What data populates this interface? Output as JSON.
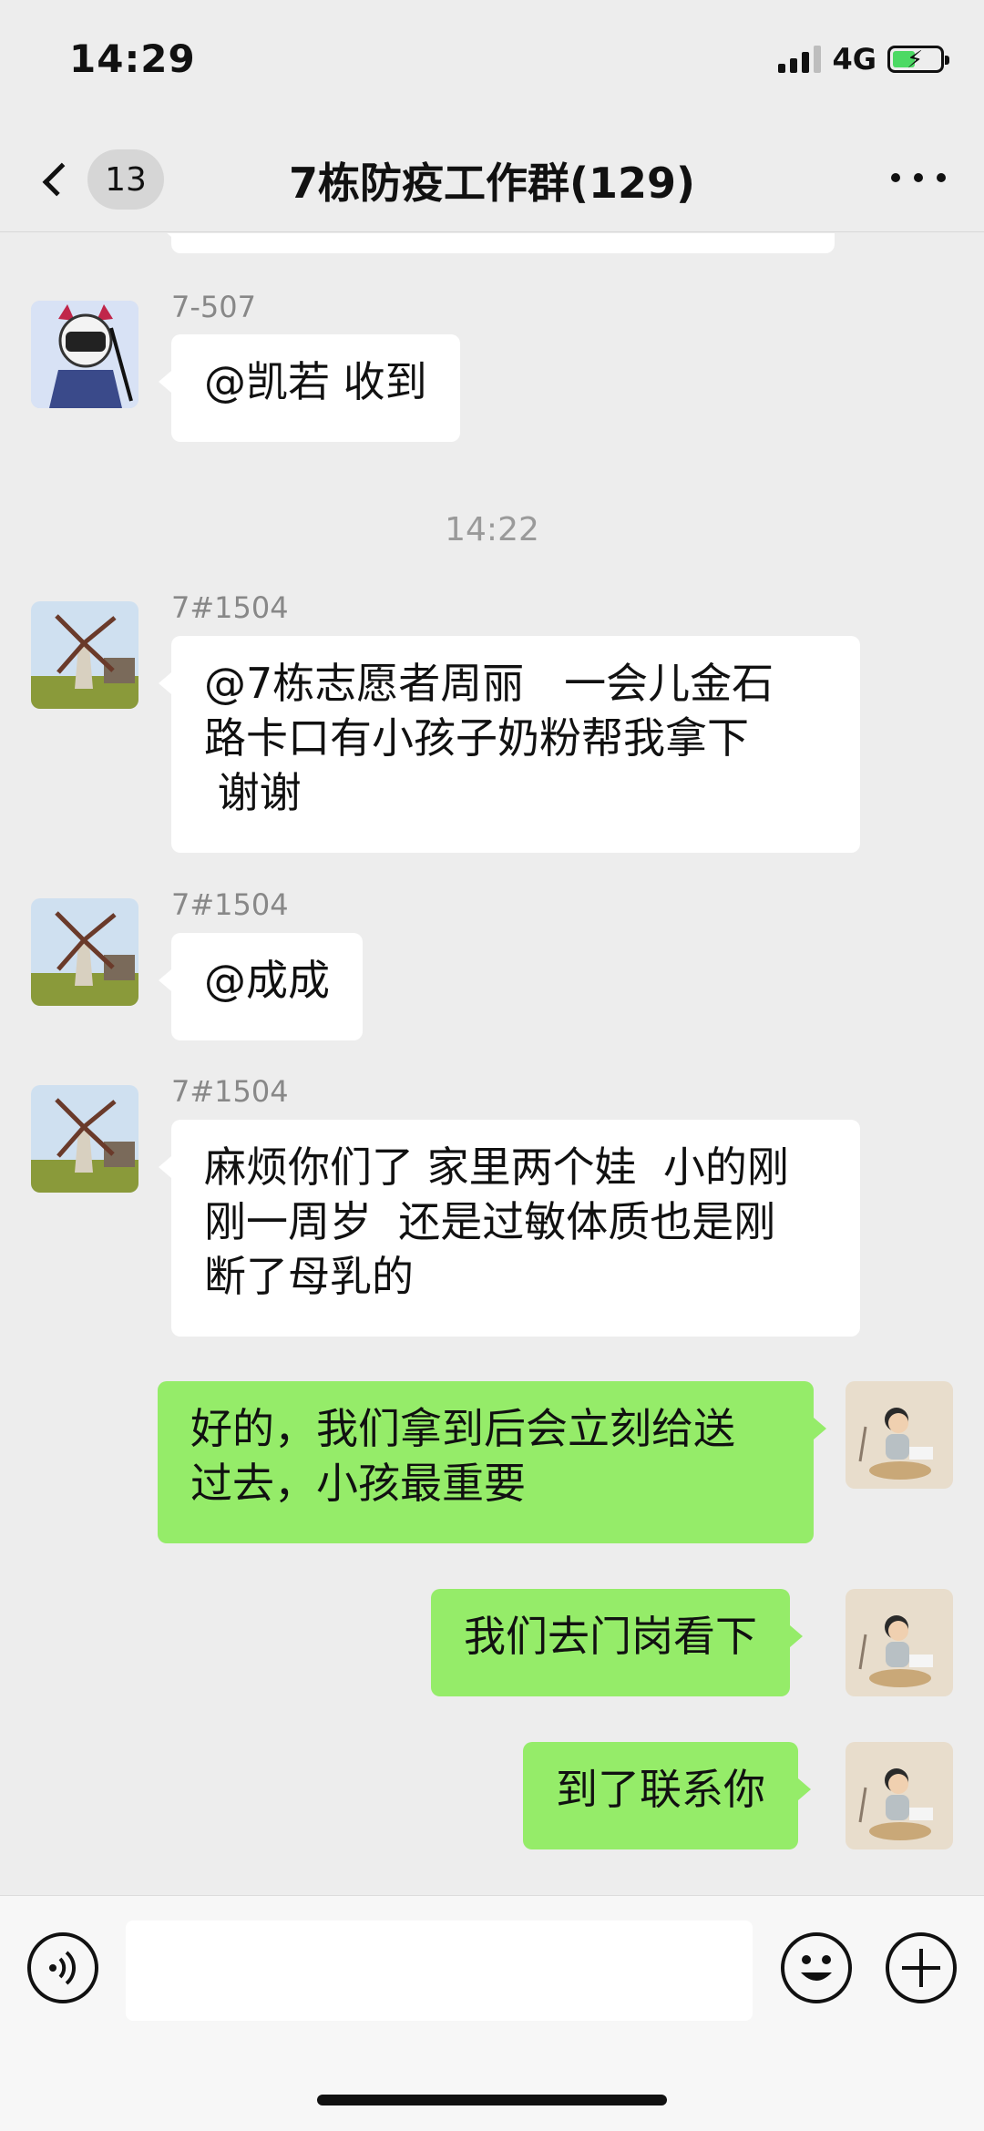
{
  "status_bar": {
    "time": "14:29",
    "network": "4G"
  },
  "header": {
    "back_badge": "13",
    "title": "7栋防疫工作群(129)"
  },
  "messages": {
    "m1": {
      "sender": "7-507",
      "text": "@凯若 收到"
    },
    "time1": "14:22",
    "m2": {
      "sender": "7#1504",
      "line1": "@7栋志愿者周丽   一会儿金石",
      "line2": "路卡口有小孩子奶粉帮我拿下",
      "line3": " 谢谢"
    },
    "m3": {
      "sender": "7#1504",
      "text": "@成成"
    },
    "m4": {
      "sender": "7#1504",
      "line1": "麻烦你们了 家里两个娃  小的刚",
      "line2": "刚一周岁  还是过敏体质也是刚",
      "line3": "断了母乳的"
    },
    "m5": {
      "line1": "好的，我们拿到后会立刻给送",
      "line2": "过去，小孩最重要"
    },
    "m6": {
      "text": "我们去门岗看下"
    },
    "m7": {
      "text": "到了联系你"
    }
  },
  "colors": {
    "background": "#ededed",
    "self_bubble": "#95ec69",
    "other_bubble": "#ffffff",
    "battery": "#4cd964"
  },
  "icons": {
    "back": "chevron-left-icon",
    "more": "more-horizontal-icon",
    "voice": "voice-icon",
    "emoji": "emoji-icon",
    "plus": "plus-icon"
  }
}
